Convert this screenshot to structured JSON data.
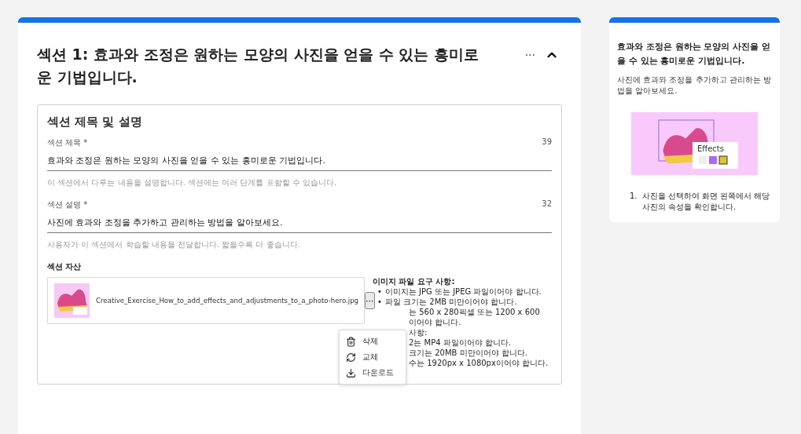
{
  "section": {
    "title": "섹션 1: 효과와 조정은 원하는 모양의 사진을 얻을 수 있는 흥미로운 기법입니다.",
    "more": "···",
    "expanded": true
  },
  "form": {
    "heading": "섹션 제목 및 설명",
    "fields": [
      {
        "label": "섹션 제목 *",
        "count": "39",
        "value": "효과와 조정은 원하는 모양의 사진을 얻을 수 있는 흥미로운 기법입니다.",
        "help": "이 섹션에서 다루는 내용을 설명합니다. 섹션에는 여러 단계를 포함할 수 있습니다."
      },
      {
        "label": "섹션 설명 *",
        "count": "32",
        "value": "사진에 효과와 조정을 추가하고 관리하는 방법을 알아보세요.",
        "help": "사용자가 이 섹션에서 학습할 내용을 전달합니다. 짧을수록 더 좋습니다."
      }
    ],
    "asset_label": "섹션 자산",
    "asset": {
      "file": "Creative_Exercise_How_to_add_effects_and_adjustments_to_a_photo-hero.jpg",
      "more": "···"
    },
    "menu": [
      {
        "kind": "delete",
        "label": "삭제"
      },
      {
        "kind": "replace",
        "label": "교체"
      },
      {
        "kind": "download",
        "label": "다운로드"
      }
    ],
    "requirements": [
      {
        "kind": "heading",
        "text": "이미지 파일 요구 사항:",
        "covered": false
      },
      {
        "kind": "bullet",
        "marker": "•",
        "text": "이미지는 JPG 또는 JPEG 파일이어야 합니다.",
        "covered": false
      },
      {
        "kind": "bullet",
        "marker": "•",
        "text": "파일 크기는 2MB 미만이어야 합니다.",
        "covered": false
      },
      {
        "kind": "plain",
        "text": "는 560 x 280픽셀 또는 1200 x 600",
        "covered": true
      },
      {
        "kind": "plain",
        "text": "이어야 합니다.",
        "covered": true
      },
      {
        "kind": "plain",
        "text": "사항:",
        "covered": true
      },
      {
        "kind": "plain",
        "text": "2는 MP4 파일이어야 합니다.",
        "covered": true
      },
      {
        "kind": "plain",
        "text": "크기는 20MB 미만이어야 합니다.",
        "covered": true
      },
      {
        "kind": "plain",
        "text": "수는 1920px x 1080px이어야 합니다.",
        "covered": true
      }
    ]
  },
  "preview": {
    "title": "효과와 조정은 원하는 모양의 사진을 얻을 수 있는 흥미로운 기법입니다.",
    "description": "사진에 효과와 조정을 추가하고 관리하는 방법을 알아보세요.",
    "panel_label": "Effects",
    "steps": [
      {
        "number": "1.",
        "text": "사진을 선택하여 화면 왼쪽에서 해당 사진의 속성을 확인합니다."
      }
    ]
  }
}
